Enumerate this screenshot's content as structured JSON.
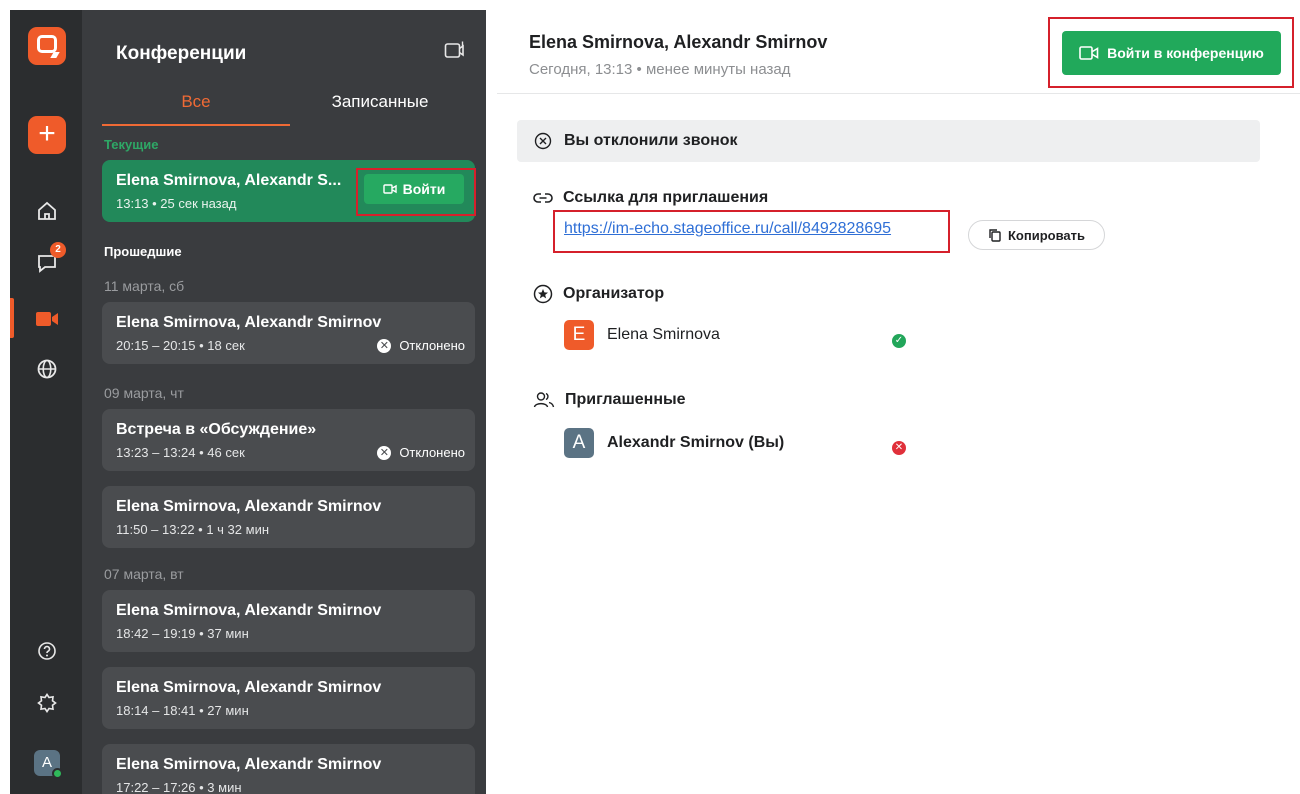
{
  "colors": {
    "accent": "#ef5b2a",
    "green": "#21a95b",
    "current_card": "#22895a",
    "highlight": "#d5202b",
    "link": "#2f6fd6"
  },
  "rail": {
    "logo_icon": "app-logo-icon",
    "add_icon": "plus-icon",
    "items": [
      {
        "name": "home-icon"
      },
      {
        "name": "chat-icon",
        "badge": "2"
      },
      {
        "name": "video-icon"
      },
      {
        "name": "globe-icon"
      }
    ],
    "help_icon": "help-icon",
    "settings_icon": "settings-icon",
    "avatar_letter": "A"
  },
  "panel": {
    "title": "Конференции",
    "tabs": [
      "Все",
      "Записанные"
    ],
    "current_label": "Текущие",
    "past_label": "Прошедшие",
    "current_card": {
      "title": "Elena Smirnova, Alexandr S...",
      "sub": "13:13 • 25 сек назад",
      "join_label": "Войти"
    },
    "groups": [
      {
        "date": "11 марта, сб"
      },
      {
        "date": "09 марта, чт"
      },
      {
        "date": "07 марта, вт"
      }
    ],
    "cards": [
      {
        "title": "Elena Smirnova, Alexandr Smirnov",
        "sub": "20:15 – 20:15 • 18 сек",
        "status": "Отклонено"
      },
      {
        "title": "Встреча в «Обсуждение»",
        "sub": "13:23 – 13:24 • 46 сек",
        "status": "Отклонено"
      },
      {
        "title": "Elena Smirnova, Alexandr Smirnov",
        "sub": "11:50 – 13:22 • 1 ч 32 мин",
        "status": ""
      },
      {
        "title": "Elena Smirnova, Alexandr Smirnov",
        "sub": "18:42 – 19:19 • 37 мин",
        "status": ""
      },
      {
        "title": "Elena Smirnova, Alexandr Smirnov",
        "sub": "18:14 – 18:41 • 27 мин",
        "status": ""
      },
      {
        "title": "Elena Smirnova, Alexandr Smirnov",
        "sub": "17:22 – 17:26 • 3 мин",
        "status": ""
      }
    ]
  },
  "main": {
    "title": "Elena Smirnova, Alexandr Smirnov",
    "subtitle": "Сегодня, 13:13 • менее минуты назад",
    "join_label": "Войти в конференцию",
    "declined_text": "Вы отклонили звонок",
    "invite_heading": "Ссылка для приглашения",
    "invite_link": "https://im-echo.stageoffice.ru/call/8492828695",
    "copy_label": "Копировать",
    "organizer_heading": "Организатор",
    "organizer": {
      "initial": "E",
      "name": "Elena Smirnova",
      "status": "accepted"
    },
    "invited_heading": "Приглашенные",
    "invited": [
      {
        "initial": "A",
        "name": "Alexandr Smirnov (Вы)",
        "status": "declined"
      }
    ]
  }
}
